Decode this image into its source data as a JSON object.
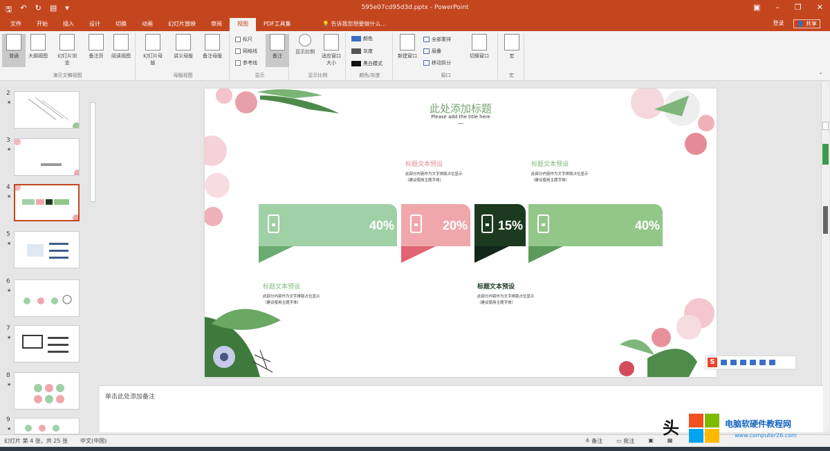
{
  "titlebar": {
    "doc_title": "595e07cd95d3d.pptx - PowerPoint"
  },
  "tabs": [
    "文件",
    "开始",
    "插入",
    "设计",
    "切换",
    "动画",
    "幻灯片放映",
    "审阅",
    "视图",
    "PDF工具集"
  ],
  "active_tab": "视图",
  "tellme": "告诉我您想要做什么...",
  "account": {
    "login": "登录",
    "share": "共享"
  },
  "ribbon": {
    "presentation_views": {
      "buttons": [
        "普通",
        "大纲视图",
        "幻灯片浏览",
        "备注页",
        "阅读视图"
      ],
      "label": "演示文稿视图"
    },
    "master_views": {
      "buttons": [
        "幻灯片母版",
        "讲义母版",
        "备注母版"
      ],
      "label": "母版视图"
    },
    "show": {
      "checks": [
        "标尺",
        "网格线",
        "参考线"
      ],
      "notes_button": "备注",
      "label": "显示"
    },
    "zoom": {
      "buttons": [
        "显示比例",
        "适应窗口大小"
      ],
      "label": "显示比例"
    },
    "color": {
      "options": [
        "颜色",
        "灰度",
        "黑白模式"
      ],
      "label": "颜色/灰度"
    },
    "window": {
      "new_window": "新建窗口",
      "small": [
        "全部重排",
        "层叠",
        "移动拆分"
      ],
      "switch": "切换窗口",
      "label": "窗口"
    },
    "macros": {
      "button": "宏",
      "label": "宏"
    }
  },
  "thumbnails": [
    {
      "num": "2"
    },
    {
      "num": "3"
    },
    {
      "num": "4"
    },
    {
      "num": "5"
    },
    {
      "num": "6"
    },
    {
      "num": "7"
    },
    {
      "num": "8"
    },
    {
      "num": "9"
    }
  ],
  "selected_slide": "4",
  "slide": {
    "title": "此处添加标题",
    "subtitle": "Please add the title here",
    "blocks": [
      {
        "heading": "标题文本预设",
        "line1": "此部分内容作为文字排版占位显示",
        "line2": "（建议使用主题字体）"
      },
      {
        "heading": "标题文本预设",
        "line1": "此部分内容作为文字排版占位显示",
        "line2": "（建议使用主题字体）"
      },
      {
        "heading": "标题文本预设",
        "line1": "此部分内容作为文字排版占位显示",
        "line2": "（建议使用主题字体）"
      },
      {
        "heading": "标题文本预设",
        "line1": "此部分内容作为文字排版占位显示",
        "line2": "（建议使用主题字体）"
      }
    ],
    "bars": [
      {
        "label": "40%",
        "value": 40,
        "color": "#9fd0a6",
        "flag": "#6aab72"
      },
      {
        "label": "20%",
        "value": 20,
        "color": "#f0a7ab",
        "flag": "#e26373"
      },
      {
        "label": "15%",
        "value": 15,
        "color": "#1c3a20",
        "flag": "#12261a"
      },
      {
        "label": "40%",
        "value": 40,
        "color": "#93c78a",
        "flag": "#5c9a5a"
      }
    ]
  },
  "notes_placeholder": "单击此处添加备注",
  "statusbar": {
    "slide_info": "幻灯片 第 4 张，共 25 张",
    "language": "中文(中国)",
    "notes": "备注",
    "comments": "批注"
  },
  "watermark": {
    "tou": "头",
    "site_name": "电脑软硬件教程网",
    "url": "www.computer26.com"
  },
  "colors": {
    "accent": "#c4461f"
  }
}
